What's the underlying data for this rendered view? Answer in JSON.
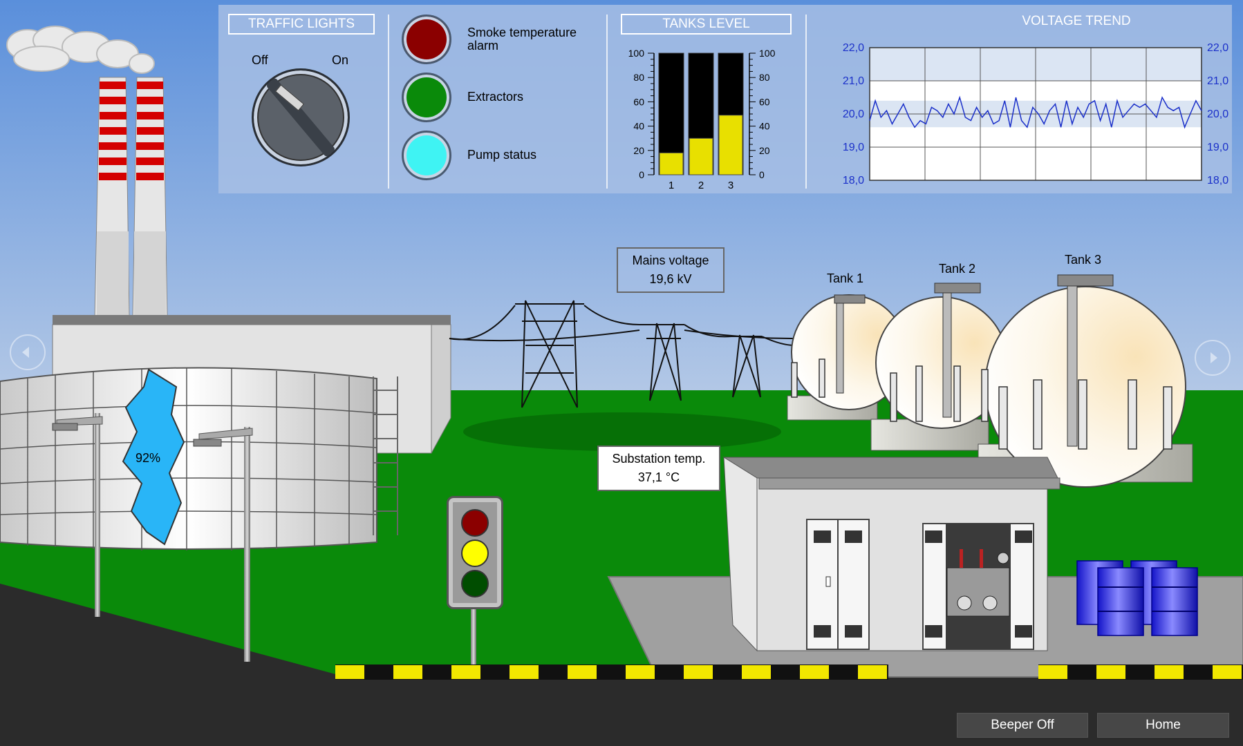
{
  "traffic_lights": {
    "title": "TRAFFIC LIGHTS",
    "off_label": "Off",
    "on_label": "On",
    "state": "Off"
  },
  "indicators": [
    {
      "label_line1": "Smoke temperature",
      "label_line2": "alarm",
      "color": "#8b0000"
    },
    {
      "label_line1": "Extractors",
      "label_line2": "",
      "color": "#0a8a0a"
    },
    {
      "label_line1": "Pump status",
      "label_line2": "",
      "color": "#3ff3f3"
    }
  ],
  "tanks_level": {
    "title": "TANKS LEVEL",
    "scale": [
      "100",
      "80",
      "60",
      "40",
      "20",
      "0"
    ],
    "bars": [
      {
        "label": "1",
        "value": 18
      },
      {
        "label": "2",
        "value": 30
      },
      {
        "label": "3",
        "value": 49
      }
    ],
    "fill_color": "#e8e000"
  },
  "voltage_trend": {
    "title": "VOLTAGE TREND",
    "y_ticks": [
      "22,0",
      "21,0",
      "20,0",
      "19,0",
      "18,0"
    ],
    "ylim": [
      18,
      22
    ],
    "values": [
      19.8,
      20.4,
      19.9,
      20.1,
      19.7,
      20.0,
      20.3,
      19.9,
      19.6,
      19.8,
      19.7,
      20.2,
      20.1,
      19.9,
      20.3,
      20.0,
      20.5,
      19.9,
      19.8,
      20.2,
      19.9,
      20.1,
      19.7,
      19.8,
      20.4,
      19.6,
      20.5,
      19.8,
      19.6,
      20.2,
      20.0,
      19.7,
      20.1,
      20.3,
      19.6,
      20.4,
      19.7,
      20.2,
      19.9,
      20.3,
      20.4,
      19.8,
      20.3,
      19.6,
      20.4,
      19.9,
      20.1,
      20.3,
      20.2,
      20.3,
      20.1,
      19.9,
      20.5,
      20.2,
      20.1,
      20.2,
      19.6,
      20.0,
      20.4,
      20.1
    ],
    "line_color": "#1a2fc9"
  },
  "scene": {
    "mains_voltage_label": "Mains voltage",
    "mains_voltage_value": "19,6 kV",
    "substation_label": "Substation temp.",
    "substation_value": "37,1 °C",
    "silo_fill_text": "92%",
    "silo_fill_value": 92,
    "tank_labels": [
      "Tank 1",
      "Tank 2",
      "Tank 3"
    ]
  },
  "buttons": {
    "beeper": "Beeper Off",
    "home": "Home"
  }
}
